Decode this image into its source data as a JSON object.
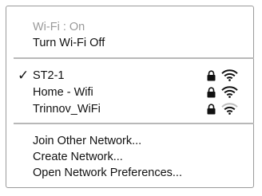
{
  "status": {
    "wifi_state": "Wi-Fi : On",
    "toggle_label": "Turn Wi-Fi Off"
  },
  "networks": [
    {
      "name": "ST2-1",
      "connected": true,
      "secured": true,
      "signal": "full"
    },
    {
      "name": "Home - Wifi",
      "connected": false,
      "secured": true,
      "signal": "full"
    },
    {
      "name": "Trinnov_WiFi",
      "connected": false,
      "secured": true,
      "signal": "medium"
    }
  ],
  "actions": {
    "join_other": "Join Other Network...",
    "create": "Create Network...",
    "preferences": "Open Network Preferences..."
  },
  "glyphs": {
    "checkmark": "✓"
  },
  "colors": {
    "text": "#111111",
    "disabled_text": "#9a9a9a",
    "separator": "#b8b8b8",
    "border": "#9a9a9a"
  }
}
